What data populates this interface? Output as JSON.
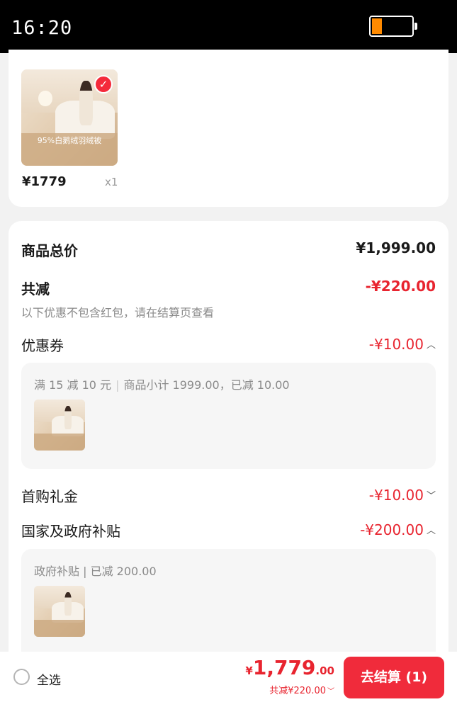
{
  "status_bar": {
    "time": "16:20",
    "battery_level": 0.25,
    "battery_fill_color": "#ff8a00"
  },
  "product": {
    "price": "¥1779",
    "quantity": "x1",
    "image_banner_text": "95%白鹅绒羽绒被",
    "selected": true
  },
  "summary": {
    "total_label": "商品总价",
    "total_value": "¥1,999.00",
    "discount_label": "共减",
    "discount_value": "-¥220.00",
    "note": "以下优惠不包含红包，请在结算页查看",
    "coupon": {
      "label": "优惠券",
      "value": "-¥10.00",
      "expanded": true,
      "detail_condition": "满 15 减 10 元",
      "detail_text": "商品小计 1999.00，已减 10.00"
    },
    "first_purchase": {
      "label": "首购礼金",
      "value": "-¥10.00",
      "expanded": false
    },
    "subsidy": {
      "label": "国家及政府补贴",
      "value": "-¥200.00",
      "expanded": true,
      "detail_text": "政府补贴 | 已减 200.00"
    }
  },
  "bottom_bar": {
    "select_all_label": "全选",
    "total_currency": "¥",
    "total_integer": "1,779",
    "total_decimal": ".00",
    "saved_text": "共减¥220.00",
    "checkout_label": "去结算 (1)"
  },
  "colors": {
    "accent_red": "#e8242f",
    "button_red": "#f02b3b",
    "background": "#f2f2f2"
  }
}
